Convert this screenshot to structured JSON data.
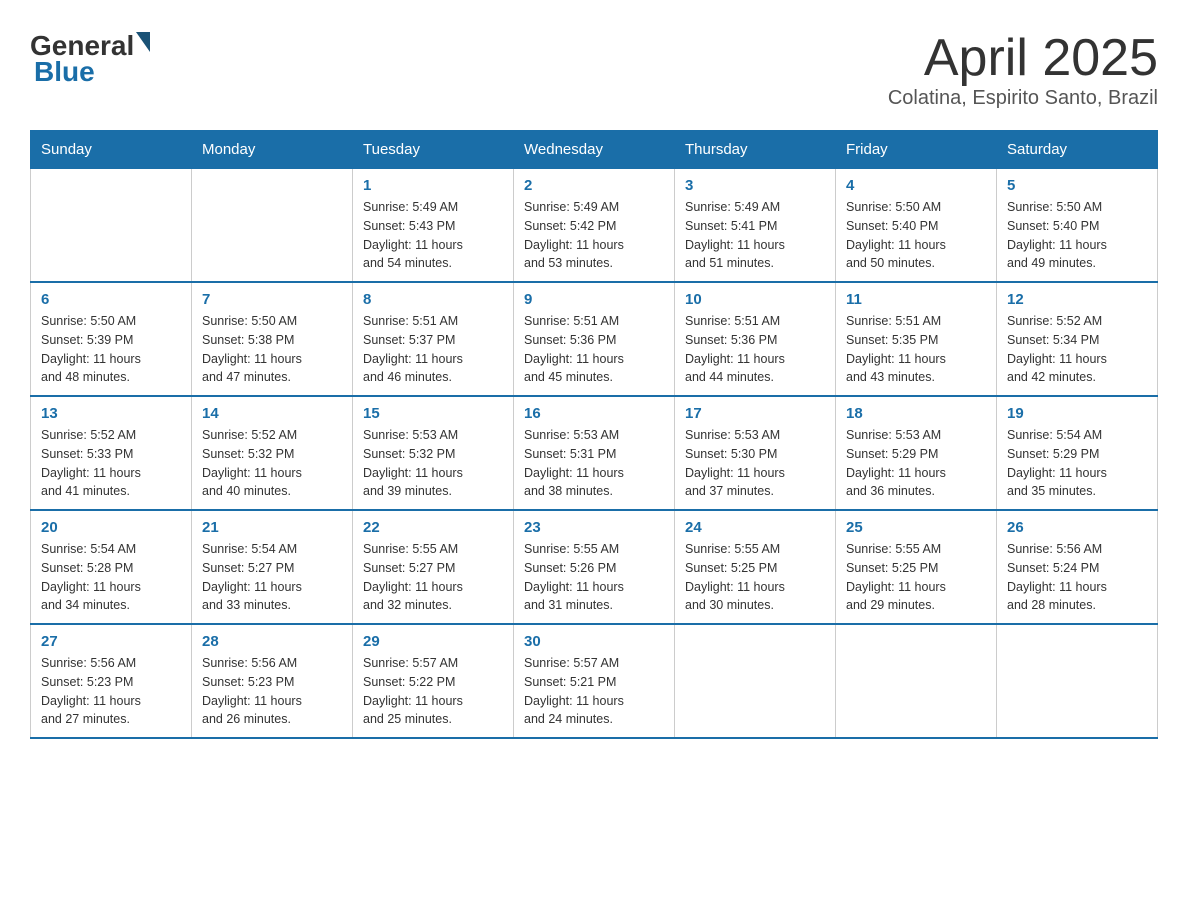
{
  "header": {
    "logo_general": "General",
    "logo_blue": "Blue",
    "title": "April 2025",
    "location": "Colatina, Espirito Santo, Brazil"
  },
  "days_of_week": [
    "Sunday",
    "Monday",
    "Tuesday",
    "Wednesday",
    "Thursday",
    "Friday",
    "Saturday"
  ],
  "weeks": [
    [
      {
        "day": "",
        "info": ""
      },
      {
        "day": "",
        "info": ""
      },
      {
        "day": "1",
        "info": "Sunrise: 5:49 AM\nSunset: 5:43 PM\nDaylight: 11 hours\nand 54 minutes."
      },
      {
        "day": "2",
        "info": "Sunrise: 5:49 AM\nSunset: 5:42 PM\nDaylight: 11 hours\nand 53 minutes."
      },
      {
        "day": "3",
        "info": "Sunrise: 5:49 AM\nSunset: 5:41 PM\nDaylight: 11 hours\nand 51 minutes."
      },
      {
        "day": "4",
        "info": "Sunrise: 5:50 AM\nSunset: 5:40 PM\nDaylight: 11 hours\nand 50 minutes."
      },
      {
        "day": "5",
        "info": "Sunrise: 5:50 AM\nSunset: 5:40 PM\nDaylight: 11 hours\nand 49 minutes."
      }
    ],
    [
      {
        "day": "6",
        "info": "Sunrise: 5:50 AM\nSunset: 5:39 PM\nDaylight: 11 hours\nand 48 minutes."
      },
      {
        "day": "7",
        "info": "Sunrise: 5:50 AM\nSunset: 5:38 PM\nDaylight: 11 hours\nand 47 minutes."
      },
      {
        "day": "8",
        "info": "Sunrise: 5:51 AM\nSunset: 5:37 PM\nDaylight: 11 hours\nand 46 minutes."
      },
      {
        "day": "9",
        "info": "Sunrise: 5:51 AM\nSunset: 5:36 PM\nDaylight: 11 hours\nand 45 minutes."
      },
      {
        "day": "10",
        "info": "Sunrise: 5:51 AM\nSunset: 5:36 PM\nDaylight: 11 hours\nand 44 minutes."
      },
      {
        "day": "11",
        "info": "Sunrise: 5:51 AM\nSunset: 5:35 PM\nDaylight: 11 hours\nand 43 minutes."
      },
      {
        "day": "12",
        "info": "Sunrise: 5:52 AM\nSunset: 5:34 PM\nDaylight: 11 hours\nand 42 minutes."
      }
    ],
    [
      {
        "day": "13",
        "info": "Sunrise: 5:52 AM\nSunset: 5:33 PM\nDaylight: 11 hours\nand 41 minutes."
      },
      {
        "day": "14",
        "info": "Sunrise: 5:52 AM\nSunset: 5:32 PM\nDaylight: 11 hours\nand 40 minutes."
      },
      {
        "day": "15",
        "info": "Sunrise: 5:53 AM\nSunset: 5:32 PM\nDaylight: 11 hours\nand 39 minutes."
      },
      {
        "day": "16",
        "info": "Sunrise: 5:53 AM\nSunset: 5:31 PM\nDaylight: 11 hours\nand 38 minutes."
      },
      {
        "day": "17",
        "info": "Sunrise: 5:53 AM\nSunset: 5:30 PM\nDaylight: 11 hours\nand 37 minutes."
      },
      {
        "day": "18",
        "info": "Sunrise: 5:53 AM\nSunset: 5:29 PM\nDaylight: 11 hours\nand 36 minutes."
      },
      {
        "day": "19",
        "info": "Sunrise: 5:54 AM\nSunset: 5:29 PM\nDaylight: 11 hours\nand 35 minutes."
      }
    ],
    [
      {
        "day": "20",
        "info": "Sunrise: 5:54 AM\nSunset: 5:28 PM\nDaylight: 11 hours\nand 34 minutes."
      },
      {
        "day": "21",
        "info": "Sunrise: 5:54 AM\nSunset: 5:27 PM\nDaylight: 11 hours\nand 33 minutes."
      },
      {
        "day": "22",
        "info": "Sunrise: 5:55 AM\nSunset: 5:27 PM\nDaylight: 11 hours\nand 32 minutes."
      },
      {
        "day": "23",
        "info": "Sunrise: 5:55 AM\nSunset: 5:26 PM\nDaylight: 11 hours\nand 31 minutes."
      },
      {
        "day": "24",
        "info": "Sunrise: 5:55 AM\nSunset: 5:25 PM\nDaylight: 11 hours\nand 30 minutes."
      },
      {
        "day": "25",
        "info": "Sunrise: 5:55 AM\nSunset: 5:25 PM\nDaylight: 11 hours\nand 29 minutes."
      },
      {
        "day": "26",
        "info": "Sunrise: 5:56 AM\nSunset: 5:24 PM\nDaylight: 11 hours\nand 28 minutes."
      }
    ],
    [
      {
        "day": "27",
        "info": "Sunrise: 5:56 AM\nSunset: 5:23 PM\nDaylight: 11 hours\nand 27 minutes."
      },
      {
        "day": "28",
        "info": "Sunrise: 5:56 AM\nSunset: 5:23 PM\nDaylight: 11 hours\nand 26 minutes."
      },
      {
        "day": "29",
        "info": "Sunrise: 5:57 AM\nSunset: 5:22 PM\nDaylight: 11 hours\nand 25 minutes."
      },
      {
        "day": "30",
        "info": "Sunrise: 5:57 AM\nSunset: 5:21 PM\nDaylight: 11 hours\nand 24 minutes."
      },
      {
        "day": "",
        "info": ""
      },
      {
        "day": "",
        "info": ""
      },
      {
        "day": "",
        "info": ""
      }
    ]
  ]
}
